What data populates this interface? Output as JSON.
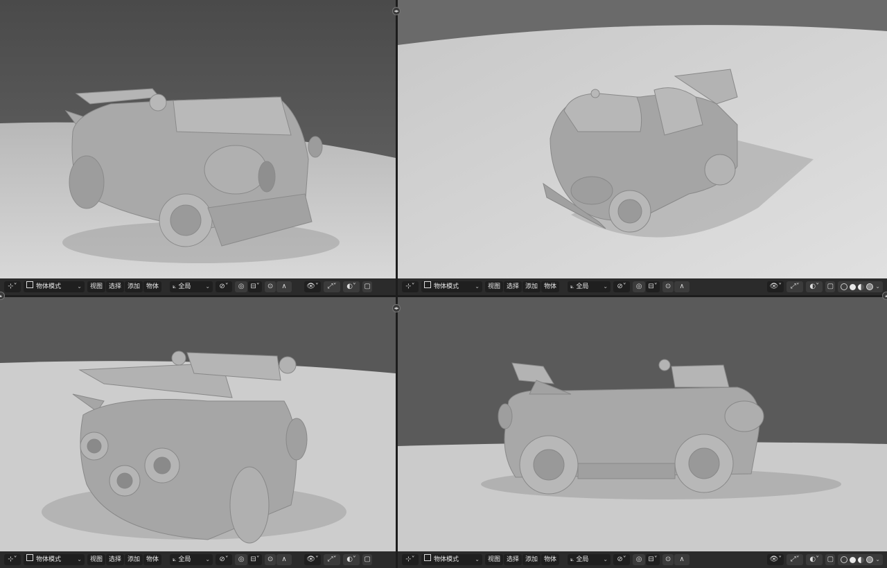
{
  "viewports": [
    {
      "id": "top-left",
      "mode_label": "物体模式",
      "menus": [
        "视图",
        "选择",
        "添加",
        "物体"
      ],
      "orientation_label": "全局"
    },
    {
      "id": "top-right",
      "mode_label": "物体模式",
      "menus": [
        "视图",
        "选择",
        "添加",
        "物体"
      ],
      "orientation_label": "全局"
    },
    {
      "id": "bottom-left",
      "mode_label": "物体模式",
      "menus": [
        "视图",
        "选择",
        "添加",
        "物体"
      ],
      "orientation_label": "全局"
    },
    {
      "id": "bottom-right",
      "mode_label": "物体模式",
      "menus": [
        "视图",
        "选择",
        "添加",
        "物体"
      ],
      "orientation_label": "全局"
    }
  ],
  "icons": {
    "editor_type": "editor-type-icon",
    "mode": "object-mode-icon",
    "orientation": "transform-orientation-icon",
    "pivot": "pivot-point-icon",
    "snap": "snap-icon",
    "proportional": "proportional-editing-icon",
    "visibility": "object-visibility-icon",
    "gizmo": "gizmo-icon",
    "overlay": "overlay-icon",
    "xray": "xray-icon",
    "shading": "shading-mode-icons"
  },
  "colors": {
    "header_bg": "#2b2b2b",
    "button_bg": "#1f1f1f",
    "background": "#555555",
    "floor": "#cfcfcf",
    "car_body": "#a7a7a7"
  }
}
